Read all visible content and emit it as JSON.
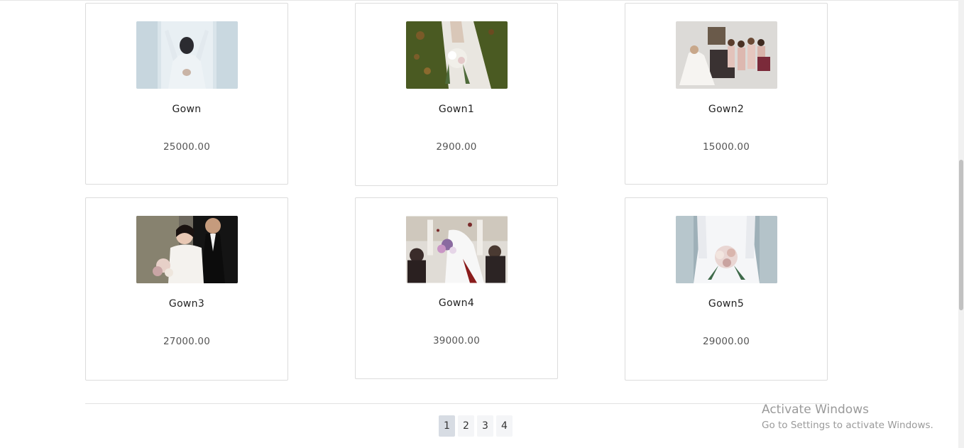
{
  "products": [
    {
      "name": "Gown",
      "price": "25000.00",
      "image": "bride-at-window-photo"
    },
    {
      "name": "Gown1",
      "price": "2900.00",
      "image": "bride-bouquet-on-grass-photo"
    },
    {
      "name": "Gown2",
      "price": "15000.00",
      "image": "bride-with-bridesmaids-photo"
    },
    {
      "name": "Gown3",
      "price": "27000.00",
      "image": "couple-embrace-photo"
    },
    {
      "name": "Gown4",
      "price": "39000.00",
      "image": "wedding-procession-photo"
    },
    {
      "name": "Gown5",
      "price": "29000.00",
      "image": "bride-holding-bouquet-photo"
    }
  ],
  "pagination": {
    "pages": [
      "1",
      "2",
      "3",
      "4"
    ],
    "current": "1"
  },
  "watermark": {
    "title": "Activate Windows",
    "subtitle": "Go to Settings to activate Windows."
  }
}
